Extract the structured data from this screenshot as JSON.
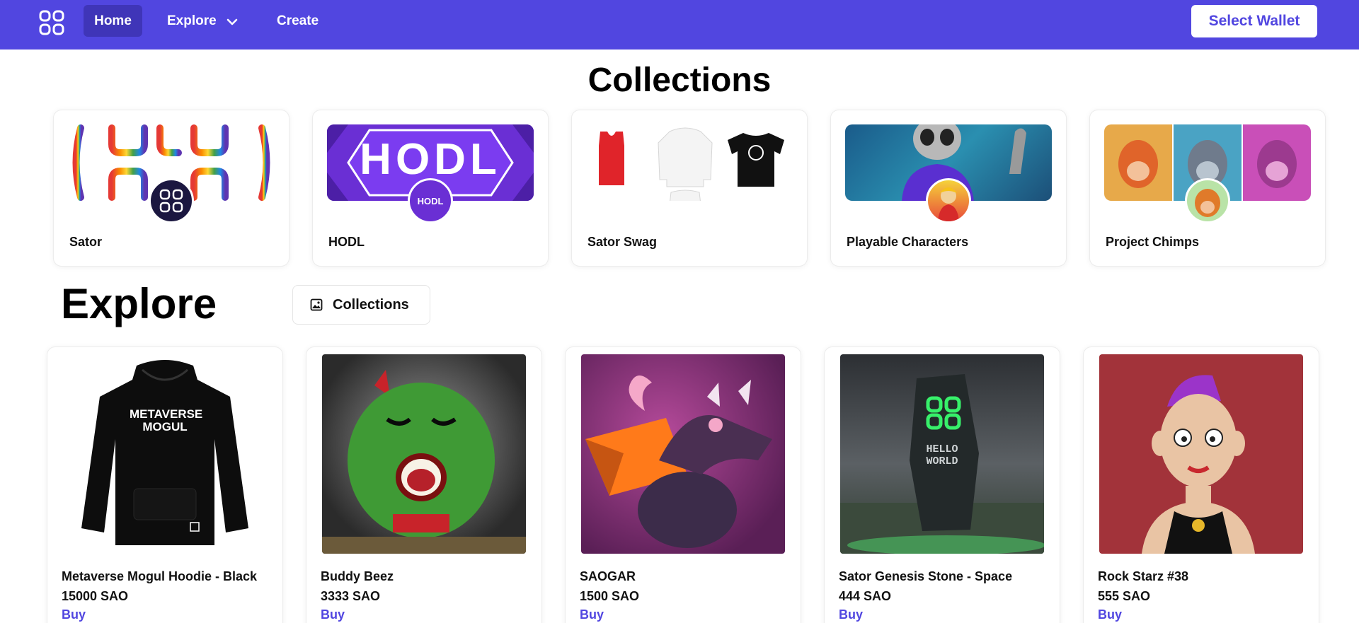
{
  "nav": {
    "home_label": "Home",
    "explore_label": "Explore",
    "create_label": "Create",
    "wallet_button": "Select Wallet",
    "logo_icon": "sator-logo-icon",
    "explore_icon": "chevron-down-icon"
  },
  "collections": {
    "title": "Collections",
    "items": [
      {
        "name": "Sator"
      },
      {
        "name": "HODL",
        "banner_text": "HODL",
        "avatar_text": "HODL"
      },
      {
        "name": "Sator Swag"
      },
      {
        "name": "Playable Characters"
      },
      {
        "name": "Project Chimps"
      }
    ]
  },
  "explore": {
    "title": "Explore",
    "tab_label": "Collections",
    "tab_icon": "image-icon",
    "items": [
      {
        "name": "Metaverse Mogul Hoodie - Black",
        "price": "15000 SAO",
        "buy": "Buy",
        "print_text": "METAVERSE MOGUL"
      },
      {
        "name": "Buddy Beez",
        "price": "3333 SAO",
        "buy": "Buy"
      },
      {
        "name": "SAOGAR",
        "price": "1500 SAO",
        "buy": "Buy"
      },
      {
        "name": "Sator Genesis Stone - Space",
        "price": "444 SAO",
        "buy": "Buy",
        "stone_text": "HELLO WORLD"
      },
      {
        "name": "Rock Starz #38",
        "price": "555 SAO",
        "buy": "Buy"
      }
    ]
  },
  "colors": {
    "brand": "#5146e0",
    "brand_dark": "#3f35b8",
    "text": "#111111",
    "background": "#ffffff"
  }
}
